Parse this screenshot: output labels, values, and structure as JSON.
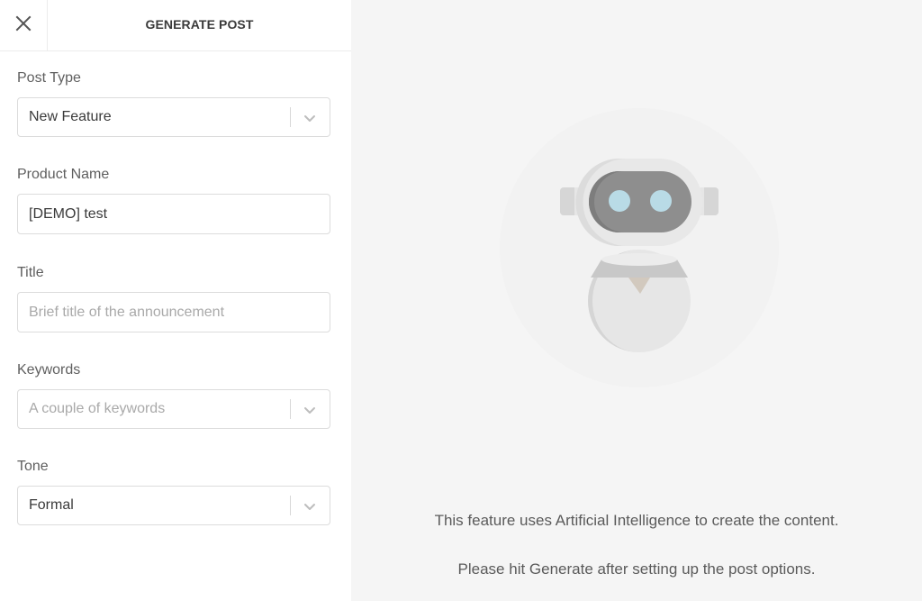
{
  "header": {
    "title": "GENERATE POST",
    "close_icon": "close-icon"
  },
  "form": {
    "post_type": {
      "label": "Post Type",
      "value": "New Feature",
      "icon": "chevron-down-icon"
    },
    "product_name": {
      "label": "Product Name",
      "value": "[DEMO] test"
    },
    "title": {
      "label": "Title",
      "value": "",
      "placeholder": "Brief title of the announcement"
    },
    "keywords": {
      "label": "Keywords",
      "value": "",
      "placeholder": "A couple of keywords",
      "icon": "chevron-down-icon"
    },
    "tone": {
      "label": "Tone",
      "value": "Formal",
      "icon": "chevron-down-icon"
    }
  },
  "preview": {
    "illustration": "robot-illustration",
    "line1": "This feature uses Artificial Intelligence to create the content.",
    "line2": "Please hit Generate after setting up the post options."
  },
  "colors": {
    "panel_bg": "#ffffff",
    "preview_bg": "#f5f5f5",
    "robot_eye": "#b9dbe6",
    "robot_visor": "#8e8e8e"
  }
}
